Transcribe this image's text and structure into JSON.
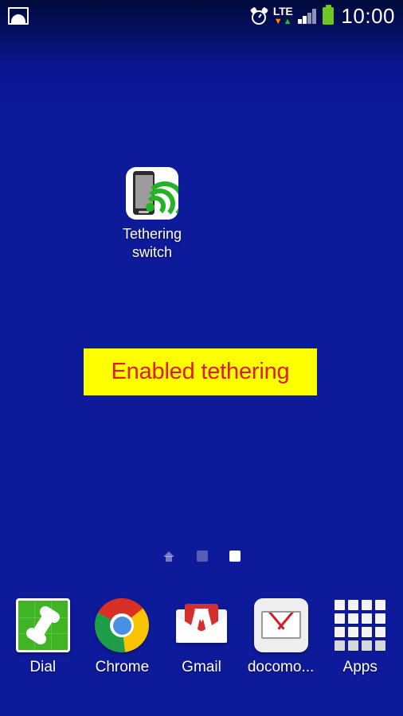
{
  "device": {
    "background_color": "#0d1a9a",
    "statusbar_color": "#00093a"
  },
  "statusbar": {
    "gallery_icon": "gallery-image-icon",
    "alarm_icon": "alarm-clock-icon",
    "network_type": "LTE",
    "data_down_arrow": "▼",
    "data_up_arrow": "▲",
    "signal_icon": "signal-bars-icon",
    "signal_bars_filled": 2,
    "signal_bars_total": 4,
    "battery_icon": "battery-icon",
    "battery_color": "#6ec821",
    "time": "10:00"
  },
  "home": {
    "app": {
      "icon": "tethering-wifi-icon",
      "label": "Tethering\nswitch"
    },
    "toast": {
      "text": "Enabled tethering",
      "background_color": "#ffff00",
      "text_color": "#e01b1b"
    },
    "page_indicator": {
      "items": [
        {
          "name": "home-page-indicator",
          "type": "home",
          "active": false
        },
        {
          "name": "page-indicator-2",
          "type": "square",
          "active": false
        },
        {
          "name": "page-indicator-3",
          "type": "square",
          "active": true
        }
      ]
    }
  },
  "dock": {
    "items": [
      {
        "label": "Dial",
        "icon": "phone-dialer-icon"
      },
      {
        "label": "Chrome",
        "icon": "chrome-browser-icon"
      },
      {
        "label": "Gmail",
        "icon": "gmail-envelope-icon"
      },
      {
        "label": "docomo...",
        "icon": "docomo-mail-envelope-icon"
      },
      {
        "label": "Apps",
        "icon": "apps-grid-icon"
      }
    ]
  }
}
